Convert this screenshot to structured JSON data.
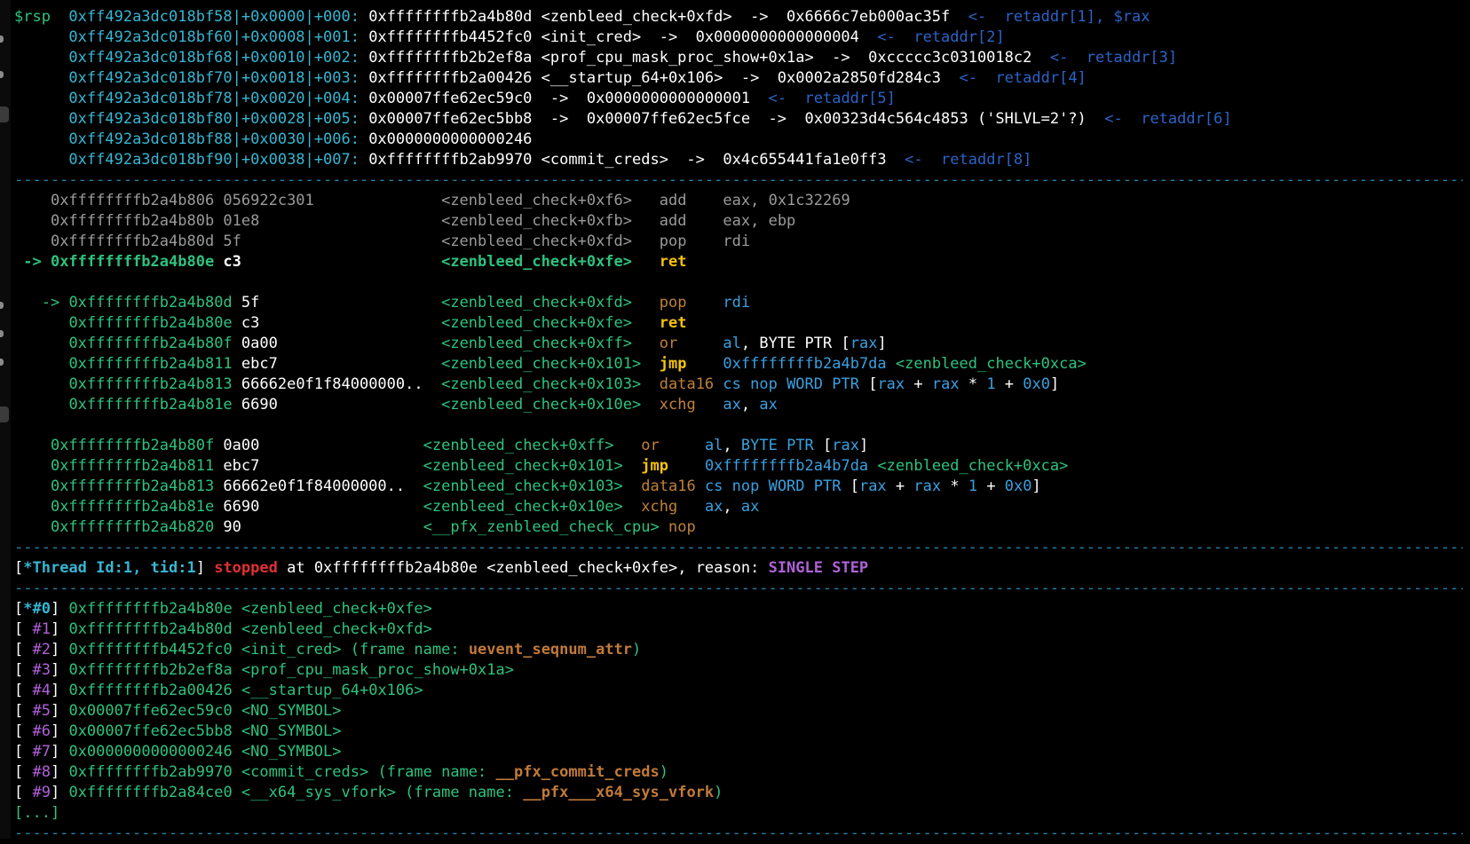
{
  "stack": [
    {
      "prefix": "$rsp  ",
      "addr": "0xff492a3dc018bf58",
      "off": "|+0x0000|+000: ",
      "val": "0xffffffffb2a4b80d",
      "sym": " <zenbleed_check+0xfd>",
      "arrow1": "  ->  ",
      "deref": "0x6666c7eb000ac35f",
      "tag_arrow": "  <-  ",
      "tag": "retaddr[1], $rax"
    },
    {
      "prefix": "      ",
      "addr": "0xff492a3dc018bf60",
      "off": "|+0x0008|+001: ",
      "val": "0xffffffffb4452fc0",
      "sym": " <init_cred>",
      "arrow1": "  ->  ",
      "deref": "0x0000000000000004",
      "tag_arrow": "  <-  ",
      "tag": "retaddr[2]"
    },
    {
      "prefix": "      ",
      "addr": "0xff492a3dc018bf68",
      "off": "|+0x0010|+002: ",
      "val": "0xffffffffb2b2ef8a",
      "sym": " <prof_cpu_mask_proc_show+0x1a>",
      "arrow1": "  ->  ",
      "deref": "0xccccc3c0310018c2",
      "tag_arrow": "  <-  ",
      "tag": "retaddr[3]"
    },
    {
      "prefix": "      ",
      "addr": "0xff492a3dc018bf70",
      "off": "|+0x0018|+003: ",
      "val": "0xffffffffb2a00426",
      "sym": " <__startup_64+0x106>",
      "arrow1": "  ->  ",
      "deref": "0x0002a2850fd284c3",
      "tag_arrow": "  <-  ",
      "tag": "retaddr[4]"
    },
    {
      "prefix": "      ",
      "addr": "0xff492a3dc018bf78",
      "off": "|+0x0020|+004: ",
      "val": "0x00007ffe62ec59c0",
      "sym": "",
      "arrow1": "  ->  ",
      "deref": "0x0000000000000001",
      "tag_arrow": "  <-  ",
      "tag": "retaddr[5]"
    },
    {
      "prefix": "      ",
      "addr": "0xff492a3dc018bf80",
      "off": "|+0x0028|+005: ",
      "val": "0x00007ffe62ec5bb8",
      "sym": "",
      "arrow1": "  ->  ",
      "deref": "0x00007ffe62ec5fce",
      "arrow2": "  ->  ",
      "deref2": "0x00323d4c564c4853 ('SHLVL=2'?)",
      "tag_arrow": "  <-  ",
      "tag": "retaddr[6]"
    },
    {
      "prefix": "      ",
      "addr": "0xff492a3dc018bf88",
      "off": "|+0x0030|+006: ",
      "val": "0x0000000000000246",
      "sym": "",
      "arrow1": "",
      "deref": "",
      "tag_arrow": "",
      "tag": ""
    },
    {
      "prefix": "      ",
      "addr": "0xff492a3dc018bf90",
      "off": "|+0x0038|+007: ",
      "val": "0xffffffffb2ab9970",
      "sym": " <commit_creds>",
      "arrow1": "  ->  ",
      "deref": "0x4c655441fa1e0ff3",
      "tag_arrow": "  <-  ",
      "tag": "retaddr[8]"
    }
  ],
  "separator": "--------------------------------------------------------------------------------------------------------------------------------------------------------------------------------------------------",
  "code_prev": [
    {
      "addr": "0xffffffffb2a4b806",
      "bytes": " 056922c301          ",
      "sym": "<zenbleed_check+0xf6>",
      "mn": "add",
      "ops": "eax, 0x1c32269"
    },
    {
      "addr": "0xffffffffb2a4b80b",
      "bytes": " 01e8                ",
      "sym": "<zenbleed_check+0xfb>",
      "mn": "add",
      "ops": "eax, ebp"
    },
    {
      "addr": "0xffffffffb2a4b80d",
      "bytes": " 5f                  ",
      "sym": "<zenbleed_check+0xfd>",
      "mn": "pop",
      "ops": "rdi"
    }
  ],
  "code_cur": {
    "arrow": " -> ",
    "addr": "0xffffffffb2a4b80e",
    "bytes": " c3                  ",
    "sym": "<zenbleed_check+0xfe>",
    "mn": "ret"
  },
  "code_nested": [
    {
      "arrow": "-> ",
      "addr": "0xffffffffb2a4b80d",
      "bytes": " 5f                  ",
      "sym": "<zenbleed_check+0xfd>",
      "mn": "pop",
      "ops_reg": "rdi"
    },
    {
      "arrow": "   ",
      "addr": "0xffffffffb2a4b80e",
      "bytes": " c3                  ",
      "sym": "<zenbleed_check+0xfe>",
      "mn": "ret"
    },
    {
      "arrow": "   ",
      "addr": "0xffffffffb2a4b80f",
      "bytes": " 0a00                ",
      "sym": "<zenbleed_check+0xff>",
      "mn": "or",
      "ops_a": "al",
      "ops_b": ", BYTE PTR [",
      "ops_c": "rax",
      "ops_d": "]"
    },
    {
      "arrow": "   ",
      "addr": "0xffffffffb2a4b811",
      "bytes": " ebc7                ",
      "sym": "<zenbleed_check+0x101>",
      "mn": "jmp",
      "target": "0xffffffffb2a4b7da",
      "tsym": " <zenbleed_check+0xca>"
    },
    {
      "arrow": "   ",
      "addr": "0xffffffffb2a4b813",
      "bytes": " 66662e0f1f84000000..",
      "sym": "<zenbleed_check+0x103>",
      "mn": "data16",
      "ops_cs": "cs nop WORD PTR",
      "ops_e": " [",
      "ops_f": "rax",
      "ops_g": " + ",
      "ops_h": "rax",
      "ops_i": " * ",
      "ops_j": "1",
      "ops_k": " + ",
      "ops_l": "0x0",
      "ops_m": "]"
    },
    {
      "arrow": "   ",
      "addr": "0xffffffffb2a4b81e",
      "bytes": " 6690                ",
      "sym": "<zenbleed_check+0x10e>",
      "mn": "xchg",
      "ops_reg": "ax",
      "ops_reg2": "ax"
    }
  ],
  "code_next": [
    {
      "addr": "0xffffffffb2a4b80f",
      "bytes": " 0a00                ",
      "sym": "<zenbleed_check+0xff>",
      "mn": "or"
    },
    {
      "addr": "0xffffffffb2a4b811",
      "bytes": " ebc7                ",
      "sym": "<zenbleed_check+0x101>",
      "mn": "jmp",
      "target": "0xffffffffb2a4b7da",
      "tsym": " <zenbleed_check+0xca>"
    },
    {
      "addr": "0xffffffffb2a4b813",
      "bytes": " 66662e0f1f84000000..",
      "sym": "<zenbleed_check+0x103>",
      "mn": "data16"
    },
    {
      "addr": "0xffffffffb2a4b81e",
      "bytes": " 6690                ",
      "sym": "<zenbleed_check+0x10e>",
      "mn": "xchg"
    },
    {
      "addr": "0xffffffffb2a4b820",
      "bytes": " 90                  ",
      "sym": "<__pfx_zenbleed_check_cpu>",
      "mn": "nop"
    }
  ],
  "thread": {
    "open": "[",
    "star_id": "*Thread Id:1, tid:1",
    "close": "] ",
    "stopped": "stopped",
    "at": " at ",
    "addr": "0xffffffffb2a4b80e",
    "sym": " <zenbleed_check+0xfe>",
    "reason_lbl": ", reason: ",
    "reason": "SINGLE STEP"
  },
  "frames": [
    {
      "idx": "*#0",
      "addr": "0xffffffffb2a4b80e",
      "sym": " <zenbleed_check+0xfe>",
      "fn_lbl": "",
      "fn": "",
      "fn_close": ""
    },
    {
      "idx": " #1",
      "addr": "0xffffffffb2a4b80d",
      "sym": " <zenbleed_check+0xfd>",
      "fn_lbl": "",
      "fn": "",
      "fn_close": ""
    },
    {
      "idx": " #2",
      "addr": "0xffffffffb4452fc0",
      "sym": " <init_cred>",
      "fn_lbl": " (frame name: ",
      "fn": "uevent_seqnum_attr",
      "fn_close": ")"
    },
    {
      "idx": " #3",
      "addr": "0xffffffffb2b2ef8a",
      "sym": " <prof_cpu_mask_proc_show+0x1a>",
      "fn_lbl": "",
      "fn": "",
      "fn_close": ""
    },
    {
      "idx": " #4",
      "addr": "0xffffffffb2a00426",
      "sym": " <__startup_64+0x106>",
      "fn_lbl": "",
      "fn": "",
      "fn_close": ""
    },
    {
      "idx": " #5",
      "addr": "0x00007ffe62ec59c0",
      "sym": " <NO_SYMBOL>",
      "fn_lbl": "",
      "fn": "",
      "fn_close": ""
    },
    {
      "idx": " #6",
      "addr": "0x00007ffe62ec5bb8",
      "sym": " <NO_SYMBOL>",
      "fn_lbl": "",
      "fn": "",
      "fn_close": ""
    },
    {
      "idx": " #7",
      "addr": "0x0000000000000246",
      "sym": " <NO_SYMBOL>",
      "fn_lbl": "",
      "fn": "",
      "fn_close": ""
    },
    {
      "idx": " #8",
      "addr": "0xffffffffb2ab9970",
      "sym": " <commit_creds>",
      "fn_lbl": " (frame name: ",
      "fn": "__pfx_commit_creds",
      "fn_close": ")"
    },
    {
      "idx": " #9",
      "addr": "0xffffffffb2a84ce0",
      "sym": " <__x64_sys_vfork>",
      "fn_lbl": " (frame name: ",
      "fn": "__pfx___x64_sys_vfork",
      "fn_close": ")"
    }
  ],
  "more": "[...]",
  "colors": {
    "bg": "#000000",
    "addr_green": "#2ec27e",
    "tag_blue": "#2b63c8",
    "cyan": "#37b6d2",
    "mnemonic": "#c0803c",
    "ret_yellow": "#f4c20d",
    "stopped_red": "#e03131",
    "reason_purple": "#b062d8"
  }
}
